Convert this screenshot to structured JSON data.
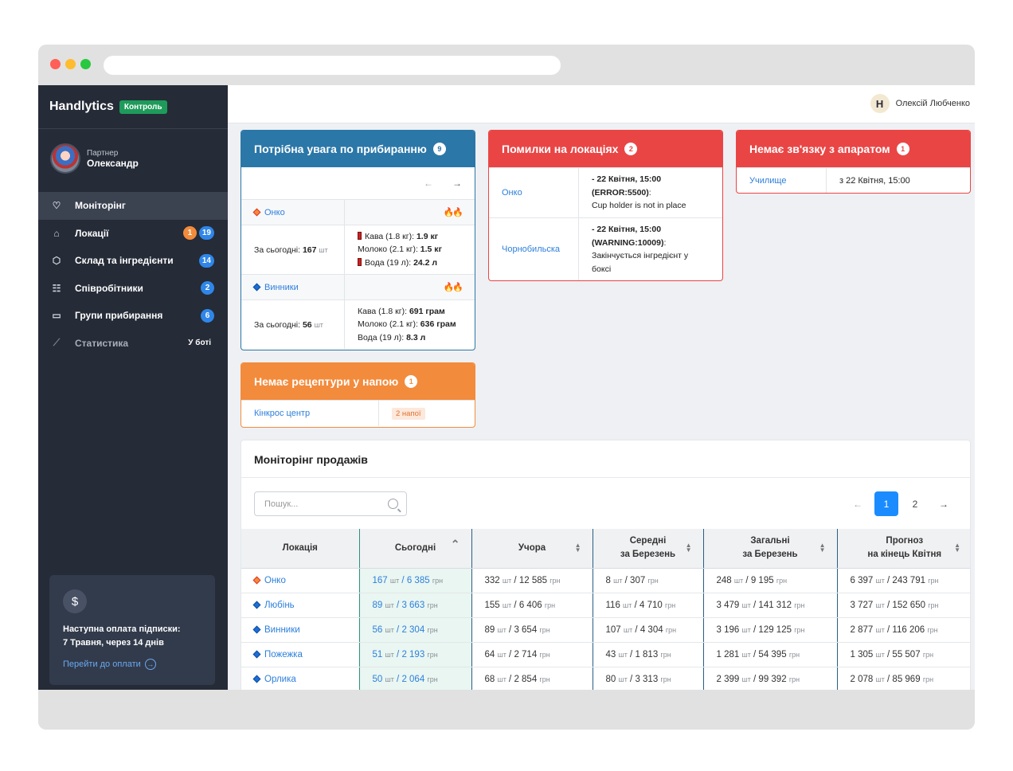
{
  "window": {
    "colors": {
      "close": "#ff5f57",
      "minimize": "#febc2e",
      "maximize": "#28c840"
    }
  },
  "sidebar": {
    "brand": "Handlytics",
    "brand_badge": "Контроль",
    "user": {
      "role": "Партнер",
      "name": "Олександр"
    },
    "items": [
      {
        "label": "Моніторінг",
        "icon": "heart-monitor-icon",
        "active": true,
        "badges": []
      },
      {
        "label": "Локації",
        "icon": "home-icon",
        "badges": [
          {
            "text": "1",
            "color": "orange"
          },
          {
            "text": "19",
            "color": "blue"
          }
        ]
      },
      {
        "label": "Склад та інгредієнти",
        "icon": "box-icon",
        "badges": [
          {
            "text": "14",
            "color": "blue"
          }
        ]
      },
      {
        "label": "Співробітники",
        "icon": "users-icon",
        "badges": [
          {
            "text": "2",
            "color": "blue"
          }
        ]
      },
      {
        "label": "Групи прибирання",
        "icon": "folder-user-icon",
        "badges": [
          {
            "text": "6",
            "color": "blue"
          }
        ]
      },
      {
        "label": "Статистика",
        "icon": "chart-icon",
        "muted": true,
        "badges": [
          {
            "text": "У боті",
            "color": "plain"
          }
        ]
      }
    ],
    "subscription": {
      "icon": "dollar-icon",
      "text_line1": "Наступна оплата підписки:",
      "text_line2": "7 Травня, через 14 днів",
      "link": "Перейти до оплати"
    }
  },
  "topbar": {
    "avatar_letter": "H",
    "user_name": "Олексій Любченко"
  },
  "cleaning": {
    "title": "Потрібна увага по прибиранню",
    "count": "9",
    "color": "#2b77a8",
    "prev": "←",
    "next": "→",
    "locations": [
      {
        "name": "Онко",
        "marker": "orange",
        "fire": "🔥🔥",
        "today_label": "За сьогодні:",
        "today_value": "167",
        "unit": "шт",
        "items": [
          {
            "warn": true,
            "label": "Кава (1.8 кг):",
            "value": "1.9 кг"
          },
          {
            "warn": false,
            "label": "Молоко (2.1 кг):",
            "value": "1.5 кг"
          },
          {
            "warn": true,
            "label": "Вода (19 л):",
            "value": "24.2 л"
          }
        ]
      },
      {
        "name": "Винники",
        "marker": "blue",
        "fire": "🔥🔥",
        "today_label": "За сьогодні:",
        "today_value": "56",
        "unit": "шт",
        "items": [
          {
            "warn": false,
            "label": "Кава (1.8 кг):",
            "value": "691 грам"
          },
          {
            "warn": false,
            "label": "Молоко (2.1 кг):",
            "value": "636 грам"
          },
          {
            "warn": false,
            "label": "Вода (19 л):",
            "value": "8.3 л"
          }
        ]
      }
    ]
  },
  "errors": {
    "title": "Помилки на локаціях",
    "count": "2",
    "color": "#ea4545",
    "rows": [
      {
        "location": "Онко",
        "date": "- 22 Квітня, 15:00",
        "code": "(ERROR:5500)",
        "message": "Cup holder is not in place"
      },
      {
        "location": "Чорнобильска",
        "date": "- 22 Квітня, 15:00",
        "code": "(WARNING:10009)",
        "message": "Закінчується інгредієнт у боксі"
      }
    ]
  },
  "no_connection": {
    "title": "Немає зв'язку з апаратом",
    "count": "1",
    "color": "#ea4545",
    "rows": [
      {
        "location": "Училище",
        "since": "з 22 Квітня, 15:00"
      }
    ]
  },
  "no_recipe": {
    "title": "Немає рецептури у напою",
    "count": "1",
    "color": "#f38b3c",
    "rows": [
      {
        "location": "Кінкрос центр",
        "tag": "2 напої"
      }
    ]
  },
  "sales": {
    "title": "Моніторінг продажів",
    "search_placeholder": "Пошук...",
    "pager": {
      "prev": "←",
      "pages": [
        "1",
        "2"
      ],
      "active": "1",
      "next": "→"
    },
    "columns": [
      {
        "line1": "Локація",
        "line2": ""
      },
      {
        "line1": "Сьогодні",
        "line2": ""
      },
      {
        "line1": "Учора",
        "line2": ""
      },
      {
        "line1": "Середні",
        "line2": "за Березень"
      },
      {
        "line1": "Загальні",
        "line2": "за Березень"
      },
      {
        "line1": "Прогноз",
        "line2": "на кінець Квітня"
      }
    ],
    "unit_pcs": "шт",
    "unit_uah": "грн",
    "rows": [
      {
        "name": "Онко",
        "marker": "orange",
        "today": [
          "167",
          "6 385"
        ],
        "yesterday": [
          "332",
          "12 585"
        ],
        "avg": [
          "8",
          "307"
        ],
        "total": [
          "248",
          "9 195"
        ],
        "forecast": [
          "6 397",
          "243 791"
        ]
      },
      {
        "name": "Любінь",
        "marker": "blue",
        "today": [
          "89",
          "3 663"
        ],
        "yesterday": [
          "155",
          "6 406"
        ],
        "avg": [
          "116",
          "4 710"
        ],
        "total": [
          "3 479",
          "141 312"
        ],
        "forecast": [
          "3 727",
          "152 650"
        ]
      },
      {
        "name": "Винники",
        "marker": "blue",
        "today": [
          "56",
          "2 304"
        ],
        "yesterday": [
          "89",
          "3 654"
        ],
        "avg": [
          "107",
          "4 304"
        ],
        "total": [
          "3 196",
          "129 125"
        ],
        "forecast": [
          "2 877",
          "116 206"
        ]
      },
      {
        "name": "Пожежка",
        "marker": "blue",
        "today": [
          "51",
          "2 193"
        ],
        "yesterday": [
          "64",
          "2 714"
        ],
        "avg": [
          "43",
          "1 813"
        ],
        "total": [
          "1 281",
          "54 395"
        ],
        "forecast": [
          "1 305",
          "55 507"
        ]
      },
      {
        "name": "Орлика",
        "marker": "blue",
        "today": [
          "50",
          "2 064"
        ],
        "yesterday": [
          "68",
          "2 854"
        ],
        "avg": [
          "80",
          "3 313"
        ],
        "total": [
          "2 399",
          "99 392"
        ],
        "forecast": [
          "2 078",
          "85 969"
        ]
      }
    ]
  }
}
